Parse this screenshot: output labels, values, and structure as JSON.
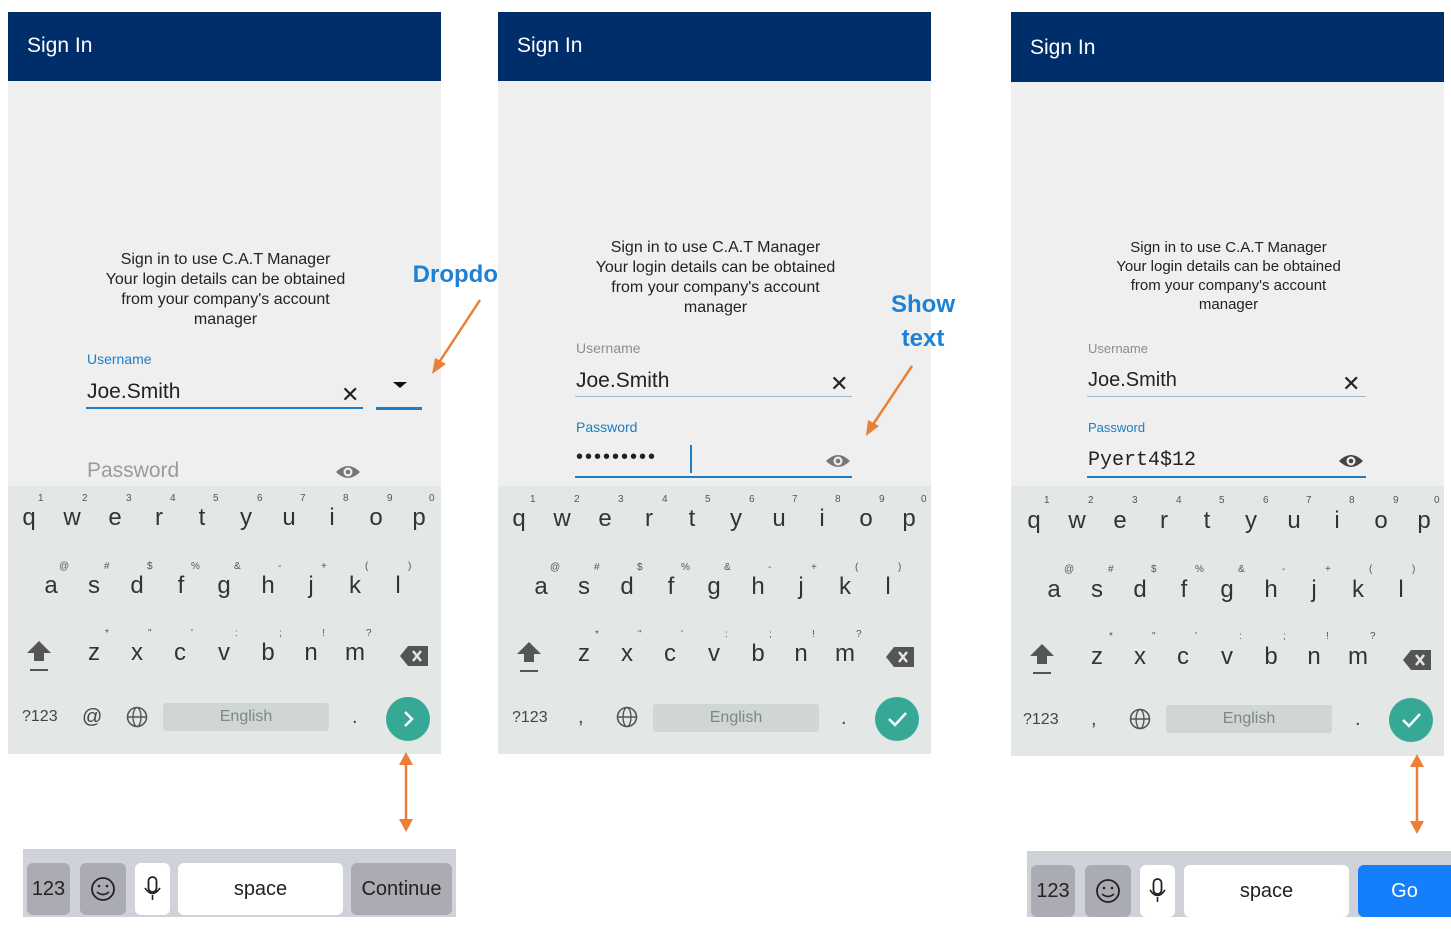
{
  "title": "Sign In",
  "intro": {
    "line1": "Sign in to use C.A.T Manager",
    "line2": "Your login details can be obtained",
    "line3": "from your company's account",
    "line4": "manager"
  },
  "username": {
    "label": "Username",
    "value": "Joe.Smith",
    "clear_icon": "close-icon"
  },
  "password": {
    "label": "Password",
    "masked_value": "•••••••••",
    "shown_value": "Pyert4$12",
    "eye_icon": "eye-icon"
  },
  "annotations": {
    "dropdown": "Dropdown",
    "show_text_1": "Show",
    "show_text_2": "text"
  },
  "android_keyboard": {
    "row1": [
      "q",
      "w",
      "e",
      "r",
      "t",
      "y",
      "u",
      "i",
      "o",
      "p"
    ],
    "row1_hints": [
      "1",
      "2",
      "3",
      "4",
      "5",
      "6",
      "7",
      "8",
      "9",
      "0"
    ],
    "row2": [
      "a",
      "s",
      "d",
      "f",
      "g",
      "h",
      "j",
      "k",
      "l"
    ],
    "row2_hints": [
      "@",
      "#",
      "$",
      "%",
      "&",
      "-",
      "+",
      "(",
      ")"
    ],
    "row3": [
      "z",
      "x",
      "c",
      "v",
      "b",
      "n",
      "m"
    ],
    "row3_hints": [
      "*",
      "\"",
      "'",
      ":",
      ";",
      "!",
      "?"
    ],
    "mode_key": "?123",
    "at_key": "@",
    "comma_key": ",",
    "space_label": "English",
    "period_key": "."
  },
  "ios_keyboard": {
    "num_key": "123",
    "space_key": "space",
    "continue_key": "Continue",
    "go_key": "Go"
  },
  "colors": {
    "appbar": "#002e6a",
    "accent": "#1a7fc7",
    "action": "#36a996",
    "annotation": "#1d82d6",
    "arrow": "#ec7f37",
    "ios_go": "#157efb"
  }
}
